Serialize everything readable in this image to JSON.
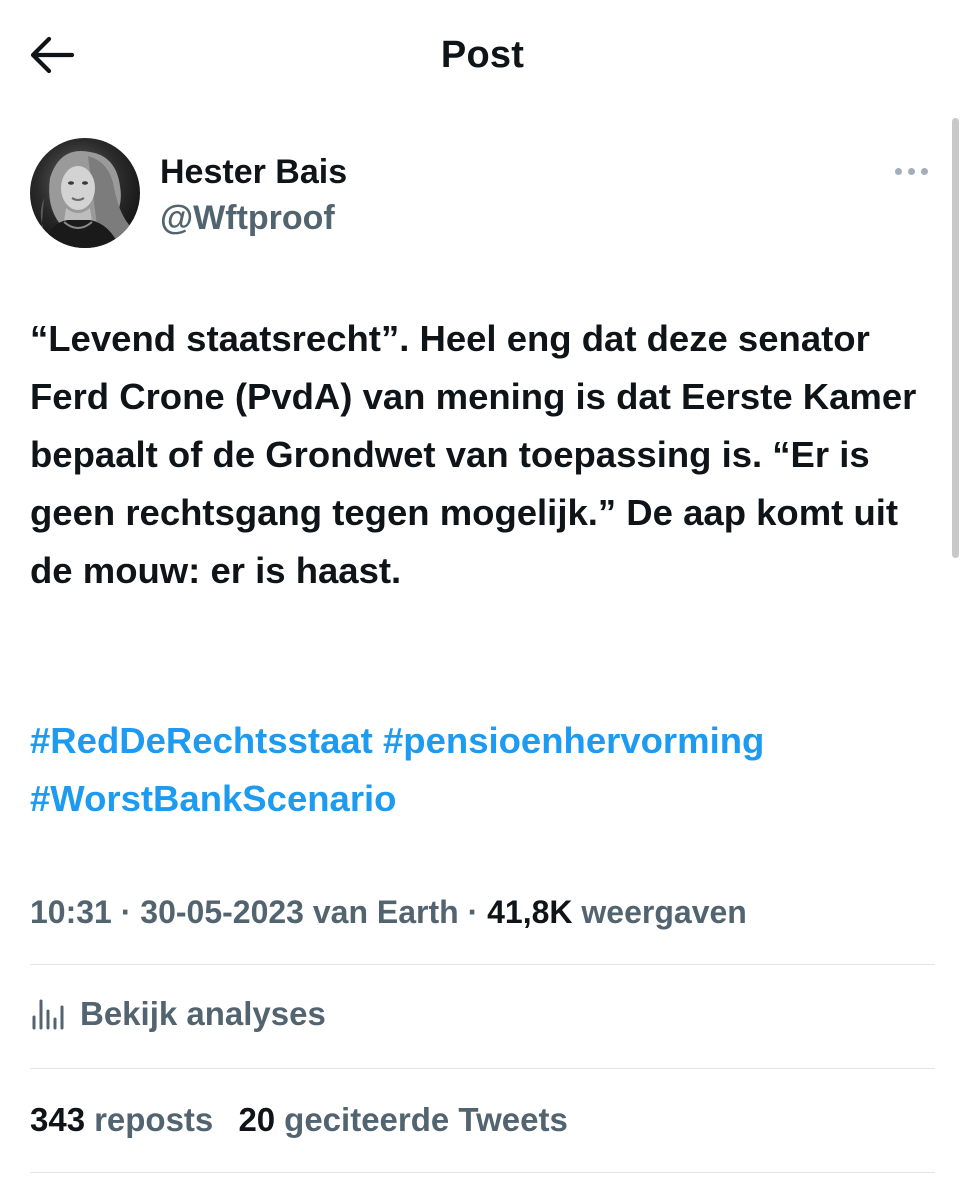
{
  "header": {
    "title": "Post",
    "back_icon": "arrow-left-icon"
  },
  "author": {
    "name": "Hester Bais",
    "handle": "@Wftproof",
    "avatar_icon": "avatar-photo",
    "more_icon": "more-horizontal-icon"
  },
  "tweet": {
    "text": "“Levend staatsrecht”. Heel eng dat deze senator Ferd Crone (PvdA) van mening is dat Eerste Kamer bepaalt of de Grondwet van toepassing is. “Er is geen rechtsgang tegen mogelijk.” De aap komt uit de mouw: er is haast.",
    "hashtags": [
      "#RedDeRechtsstaat",
      "#pensioenhervorming",
      "#WorstBankScenario"
    ]
  },
  "meta": {
    "time": "10:31",
    "separator": " · ",
    "date": "30-05-2023",
    "source_prefix": " van ",
    "source": "Earth",
    "views_count": "41,8K",
    "views_label": " weergaven"
  },
  "analytics": {
    "icon": "analytics-bar-chart-icon",
    "label": "Bekijk analyses"
  },
  "stats": {
    "reposts_count": "343",
    "reposts_label": "reposts",
    "quotes_count": "20",
    "quotes_label": "geciteerde Tweets"
  },
  "colors": {
    "text_primary": "#0f1419",
    "text_secondary": "#536471",
    "link": "#1d9bf0",
    "divider": "#e1e5e8"
  }
}
